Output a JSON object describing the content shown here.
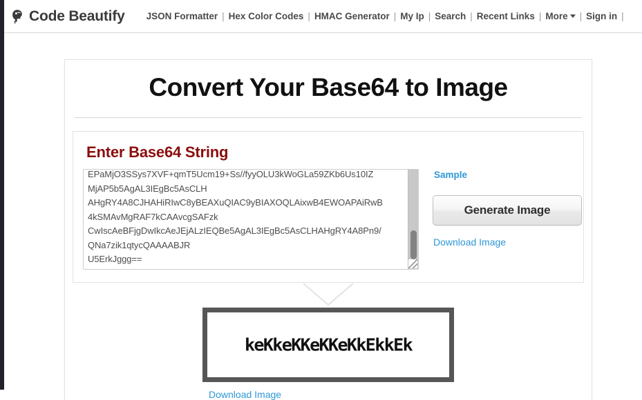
{
  "header": {
    "brand": {
      "name": "Code Beautify",
      "icon": "brain-head-icon"
    },
    "nav_items": [
      {
        "label": "JSON Formatter",
        "has_caret": false
      },
      {
        "label": "Hex Color Codes",
        "has_caret": false
      },
      {
        "label": "HMAC Generator",
        "has_caret": false
      },
      {
        "label": "My Ip",
        "has_caret": false
      },
      {
        "label": "Search",
        "has_caret": false
      },
      {
        "label": "Recent Links",
        "has_caret": false
      },
      {
        "label": "More",
        "has_caret": true
      },
      {
        "label": "Sign in",
        "has_caret": false
      }
    ],
    "separator": "|"
  },
  "main": {
    "title": "Convert Your Base64 to Image",
    "input_panel": {
      "heading": "Enter Base64 String",
      "textarea_value": "EPaMjO3SSys7XVF+qmT5Ucm19+Ss//fyyOLU3kWoGLa59ZKb6Us10IZ\nMjAP5b5AgAL3IEgBc5AsCLH\nAHgRY4A8CJHAHiRIwC8yBEAXuQIAC9yBIAXOQLAixwB4EWOAPAiRwB\n4kSMAvMgRAF7kCAAvcgSAFzk\nCwIscAeBFjgDwIkcAeJEjALzIEQBe5AgAL3IEgBc5AsCLHAHgRY4A8Pn9/\nQNa7zik1qtycQAAAABJR\nU5ErkJggg==",
      "textarea_placeholder": "",
      "sample_link": "Sample",
      "generate_button": "Generate Image",
      "download_link": "Download Image"
    },
    "output": {
      "image_text": "keKkeKKeKKeKkEkkEk",
      "download_link": "Download Image"
    }
  },
  "colors": {
    "heading_red": "#8b0d0d",
    "link_blue": "#2e96d8",
    "image_border": "#565656",
    "nav_text": "#4a4a4a"
  }
}
